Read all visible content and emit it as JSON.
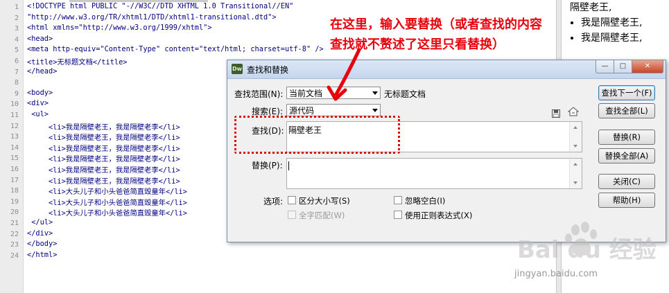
{
  "editor": {
    "line_numbers": [
      "1",
      "2",
      "3",
      "4",
      "5",
      "6",
      "7",
      "8",
      "9",
      "10",
      "11",
      "12",
      "13",
      "14",
      "15",
      "16",
      "17",
      "18",
      "19",
      "20",
      "21",
      "22",
      "23",
      "24"
    ],
    "lines": [
      "<!DOCTYPE html PUBLIC \"-//W3C//DTD XHTML 1.0 Transitional//EN\"",
      "\"http://www.w3.org/TR/xhtml1/DTD/xhtml1-transitional.dtd\">",
      "<html xmlns=\"http://www.w3.org/1999/xhtml\">",
      "<head>",
      "<meta http-equiv=\"Content-Type\" content=\"text/html; charset=utf-8\" />",
      "<title>无标题文档</title>",
      "</head>",
      "",
      "<body>",
      "<div>",
      " <ul>",
      "     <li>我是隔壁老王，我是隔壁老李</li>",
      "     <li>我是隔壁老王，我是隔壁老李</li>",
      "     <li>我是隔壁老王，我是隔壁老李</li>",
      "     <li>我是隔壁老王，我是隔壁老李</li>",
      "     <li>我是隔壁老王，我是隔壁老李</li>",
      "     <li>我是隔壁老王，我是隔壁老李</li>",
      "     <li>大头儿子和小头爸爸简直毁童年</li>",
      "     <li>大头儿子和小头爸爸简直毁童年</li>",
      "     <li>大头儿子和小头爸爸简直毁童年</li>",
      " </ul>",
      "</div>",
      "</body>",
      "</html>"
    ]
  },
  "preview": {
    "first_line": "隔壁老王,",
    "items": [
      "我是隔壁老王,",
      "我是隔壁老王,"
    ]
  },
  "annotation": {
    "line1": "在这里，输入要替换（或者查找的内容",
    "line2": "查找就不赘述了这里只看替换）"
  },
  "dialog": {
    "title": "查找和替换",
    "app_icon": "Dw",
    "scope_label": "查找范围(N):",
    "scope_value": "当前文档",
    "scope_doc": "无标题文档",
    "search_label": "搜索(E):",
    "search_value": "源代码",
    "find_label": "查找(D):",
    "find_value": "隔壁老王",
    "replace_label": "替换(P):",
    "replace_value": "",
    "options_label": "选项:",
    "options": {
      "match_case": "区分大小写(S)",
      "whole_word": "全字匹配(W)",
      "ignore_whitespace": "忽略空白(I)",
      "regex": "使用正则表达式(X)"
    },
    "buttons": {
      "find_next": "查找下一个(F)",
      "find_all": "查找全部(L)",
      "replace": "替换(R)",
      "replace_all": "替换全部(A)",
      "close": "关闭(C)",
      "help": "帮助(H)"
    }
  },
  "watermark": {
    "brand": "Bai du 经验",
    "url": "jingyan.baidu.com"
  },
  "colors": {
    "annotation_red": "#e8000b",
    "code_tag": "#000080",
    "code_string": "#0033cc"
  }
}
